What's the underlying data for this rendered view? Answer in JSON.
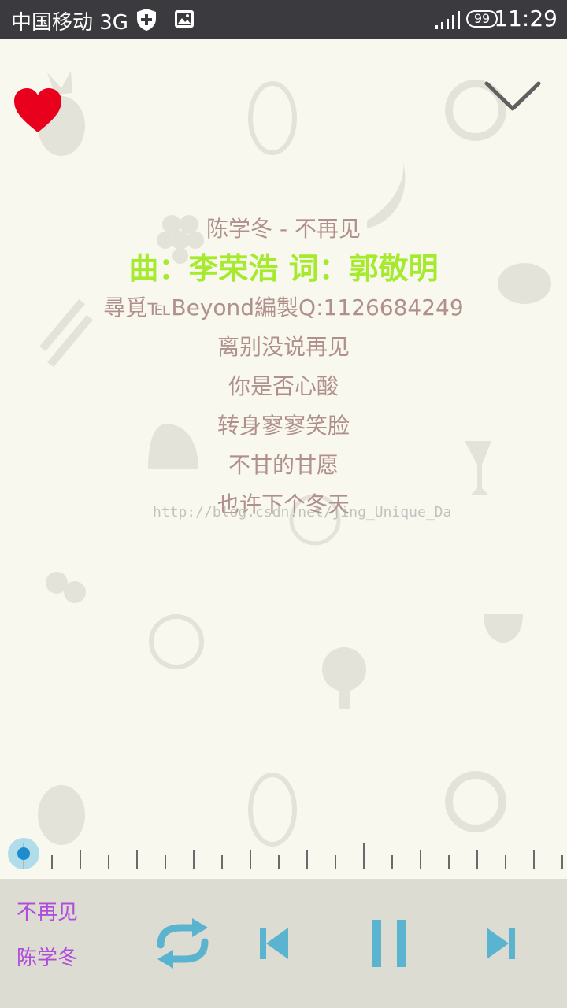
{
  "status_bar": {
    "carrier": "中国移动 3G",
    "battery": "99",
    "time": "11:29"
  },
  "lyrics": {
    "lines": [
      "陈学冬 - 不再见",
      "曲：李荣浩 词：郭敬明",
      "尋覓℡Beyond編製Q:1126684249",
      "离别没说再见",
      "你是否心酸",
      "转身寥寥笑脸",
      "不甘的甘愿",
      "也许下个冬天"
    ],
    "active_index": 1
  },
  "watermark": "http://blog.csdn.net/jing_Unique_Da",
  "progress": {
    "fraction": 0.0
  },
  "now_playing": {
    "title": "不再见",
    "artist": "陈学冬"
  },
  "colors": {
    "accent_lyric": "#a6ea2e",
    "lyric": "#b0908c",
    "controls": "#5ab4d0",
    "track_text": "#b04ed9",
    "heart": "#e8001c"
  }
}
